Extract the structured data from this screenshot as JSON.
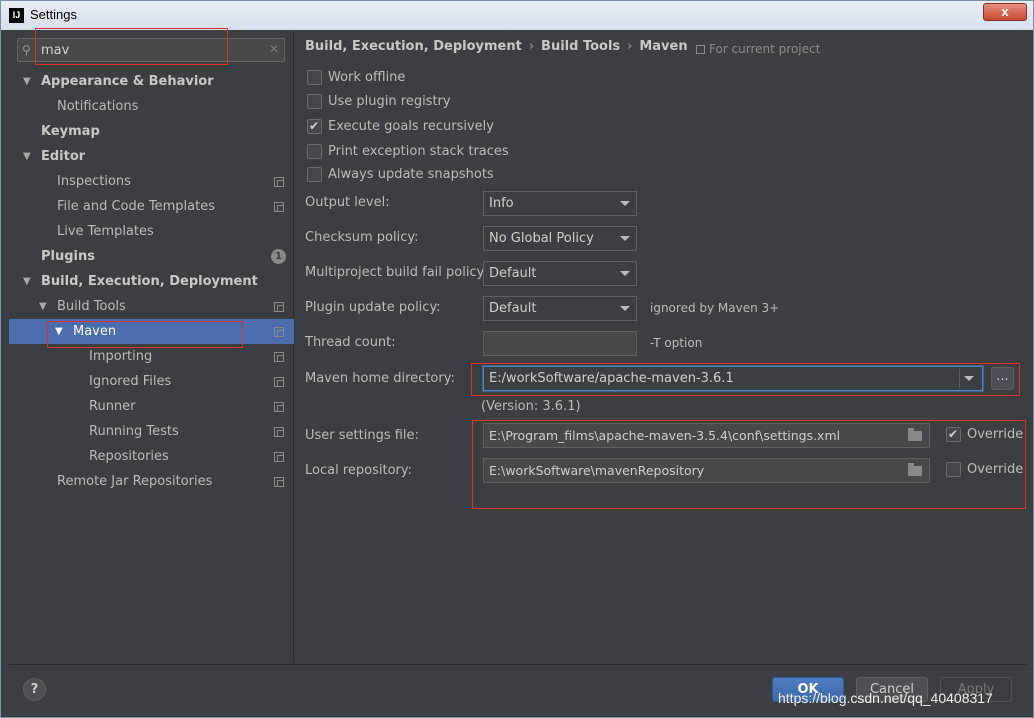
{
  "window": {
    "title": "Settings",
    "close_label": "x",
    "app_icon_text": "IJ"
  },
  "search": {
    "value": "mav"
  },
  "tree": [
    {
      "label": "Appearance & Behavior",
      "level": 0,
      "bold": true,
      "expand": true
    },
    {
      "label": "Notifications",
      "level": 1
    },
    {
      "label": "Keymap",
      "level": 0,
      "bold": true
    },
    {
      "label": "Editor",
      "level": 0,
      "bold": true,
      "expand": true
    },
    {
      "label": "Inspections",
      "level": 1,
      "copy": true
    },
    {
      "label": "File and Code Templates",
      "level": 1,
      "copy": true
    },
    {
      "label": "Live Templates",
      "level": 1
    },
    {
      "label": "Plugins",
      "level": 0,
      "bold": true,
      "badge": "1"
    },
    {
      "label": "Build, Execution, Deployment",
      "level": 0,
      "bold": true,
      "expand": true
    },
    {
      "label": "Build Tools",
      "level": 1,
      "expand": true,
      "copy": true
    },
    {
      "label": "Maven",
      "level": 2,
      "expand": true,
      "copy": true,
      "selected": true
    },
    {
      "label": "Importing",
      "level": 3,
      "copy": true
    },
    {
      "label": "Ignored Files",
      "level": 3,
      "copy": true
    },
    {
      "label": "Runner",
      "level": 3,
      "copy": true
    },
    {
      "label": "Running Tests",
      "level": 3,
      "copy": true
    },
    {
      "label": "Repositories",
      "level": 3,
      "copy": true
    },
    {
      "label": "Remote Jar Repositories",
      "level": 1,
      "copy": true
    }
  ],
  "breadcrumb": [
    "Build, Execution, Deployment",
    "Build Tools",
    "Maven"
  ],
  "scope_note": "For current project",
  "checkboxes": [
    {
      "label": "Work offline",
      "checked": false
    },
    {
      "label": "Use plugin registry",
      "checked": false
    },
    {
      "label": "Execute goals recursively",
      "checked": true
    },
    {
      "label": "Print exception stack traces",
      "checked": false
    },
    {
      "label": "Always update snapshots",
      "checked": false
    }
  ],
  "fields": {
    "output_level": {
      "label": "Output level:",
      "value": "Info"
    },
    "checksum_policy": {
      "label": "Checksum policy:",
      "value": "No Global Policy"
    },
    "multiproject_fail": {
      "label": "Multiproject build fail policy:",
      "value": "Default"
    },
    "plugin_update": {
      "label": "Plugin update policy:",
      "value": "Default",
      "hint": "ignored by Maven 3+"
    },
    "thread_count": {
      "label": "Thread count:",
      "value": "",
      "hint": "-T option"
    },
    "maven_home": {
      "label": "Maven home directory:",
      "value": "E:/workSoftware/apache-maven-3.6.1",
      "browse": "...",
      "version": "(Version: 3.6.1)"
    },
    "user_settings": {
      "label": "User settings file:",
      "value": "E:\\Program_films\\apache-maven-3.5.4\\conf\\settings.xml",
      "override_label": "Override",
      "override_checked": true
    },
    "local_repo": {
      "label": "Local repository:",
      "value": "E:\\workSoftware\\mavenRepository",
      "override_label": "Override",
      "override_checked": false
    }
  },
  "buttons": {
    "help": "?",
    "ok": "OK",
    "cancel": "Cancel",
    "apply": "Apply"
  },
  "watermark": "https://blog.csdn.net/qq_40408317",
  "colors": {
    "selection": "#4b6eaf",
    "highlight_box": "#e0302e",
    "background": "#3c3f41"
  }
}
